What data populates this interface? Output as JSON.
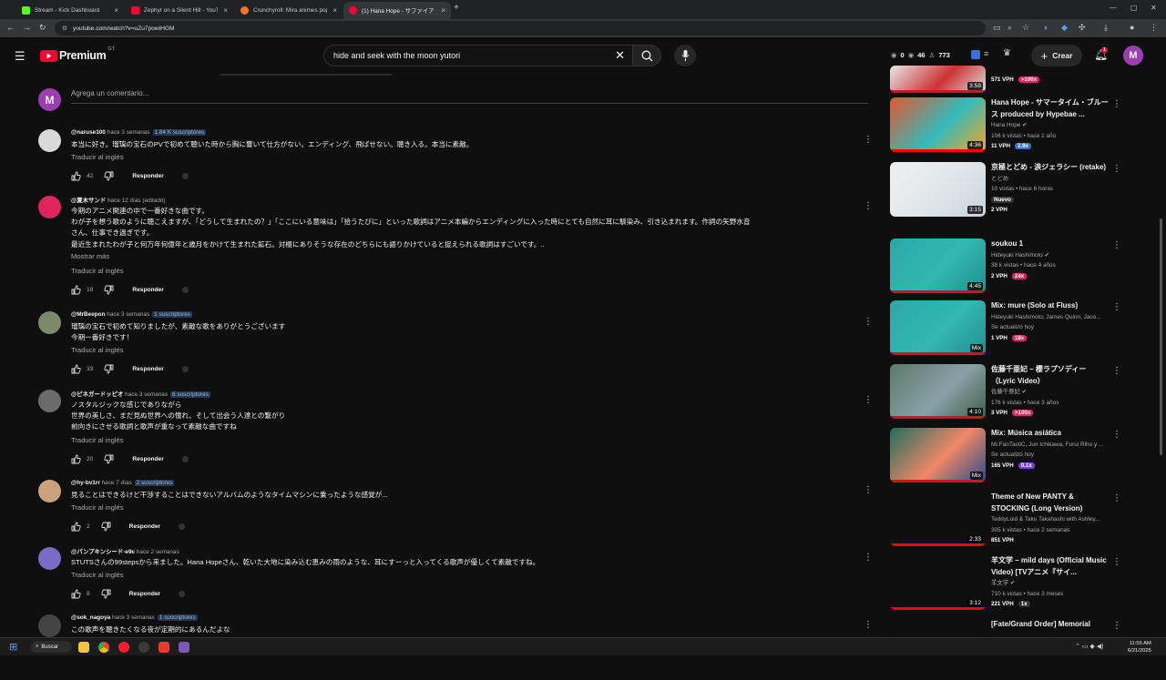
{
  "browser": {
    "tabs": [
      {
        "title": "Stream - Kick Dashboard",
        "color": "#53fc18",
        "active": false
      },
      {
        "title": "Zephyr on a Silent Hill - YouTub",
        "color": "#ff0033",
        "active": false
      },
      {
        "title": "Crunchyroll: Mira animes popul",
        "color": "#f47521",
        "active": false
      },
      {
        "title": "(1) Hana Hope - サファイア -",
        "color": "#ff0033",
        "active": true
      }
    ],
    "url": "youtube.com/watch?v=uZu7powiHGM"
  },
  "header": {
    "logo_text": "Premium",
    "logo_region": "GT",
    "search_value": "hide and seek with the moon yutori",
    "stats": {
      "views": "0",
      "watching": "46",
      "users": "773"
    },
    "create_label": "Crear",
    "notif_count": "1",
    "avatar_letter": "M"
  },
  "comment_box": {
    "placeholder": "Agrega un comentario..."
  },
  "comments": [
    {
      "author": "@naruse100",
      "time": "hace 3 semanas",
      "badge": "1.84 K suscriptores",
      "lines": [
        "本当に好き。瑠璃の宝石のPVで初めて聴いた時から胸に響いて仕方がない。エンディング、飛ばせない。聴き入る。本当に素敵。"
      ],
      "more": "",
      "translate": "Traducir al inglés",
      "likes": "42",
      "reply": "Responder",
      "avatar_color": "#d9d9d9"
    },
    {
      "author": "@夏木サンド",
      "time": "hace 12 días (editado)",
      "badge": "",
      "lines": [
        "今期のアニメ関連の中で一番好きな曲です。",
        "わが子を想う歌のように聴こえますが、「どうして生まれたの？」「ここにいる意味は」「拾うたびに」といった歌詞はアニメ本編からエンディングに入った時にとても自然に耳に馴染み、引き込まれます。作詞の矢野水音",
        "さん、仕事でき過ぎです。",
        "最近生まれたわが子と何万年何億年と歳月をかけて生まれた鉱石。対極にありそうな存在のどちらにも語りかけていると捉えられる歌詞はすごいです。.."
      ],
      "more": "Mostrar más",
      "translate": "Traducir al inglés",
      "likes": "18",
      "reply": "Responder",
      "avatar_color": "#e0245e"
    },
    {
      "author": "@MrBeepon",
      "time": "hace 3 semanas",
      "badge": "1 suscriptores",
      "lines": [
        "瑠璃の宝石で初めて知りましたが、素敵な歌をありがとうございます",
        "今期一番好きです！"
      ],
      "more": "",
      "translate": "Traducir al inglés",
      "likes": "33",
      "reply": "Responder",
      "avatar_color": "#7a8a6a"
    },
    {
      "author": "@ピネガードッピオ",
      "time": "hace 3 semanas",
      "badge": "6 suscriptores",
      "lines": [
        "ノスタルジックな感じでありながら",
        "世界の美しさ、まだ見ぬ世界への憧れ、そして出会う人達との繋がり",
        "前向きにさせる歌詞と歌声が重なって素敵な曲ですね"
      ],
      "more": "",
      "translate": "Traducir al inglés",
      "likes": "20",
      "reply": "Responder",
      "avatar_color": "#6b6b6b"
    },
    {
      "author": "@hy-bv1rr",
      "time": "hace 7 días",
      "badge": "2 suscriptores",
      "lines": [
        "見ることはできるけど干渉することはできないアルバムのようなタイムマシンに乗ったような感覚が..."
      ],
      "more": "",
      "translate": "Traducir al inglés",
      "likes": "2",
      "reply": "Responder",
      "avatar_color": "#c9a27e"
    },
    {
      "author": "@パンプキンシード-e9c",
      "time": "hace 2 semanas",
      "badge": "",
      "lines": [
        "STUTSさんの99stepsから来ました。Hana Hopeさん、乾いた大地に染み込む恵みの雨のような、耳にすーっと入ってくる歌声が優しくて素敵ですね。"
      ],
      "more": "",
      "translate": "Traducir al inglés",
      "likes": "8",
      "reply": "Responder",
      "avatar_color": "#7a6cc4"
    },
    {
      "author": "@sok_nagoya",
      "time": "hace 3 semanas",
      "badge": "1 suscriptores",
      "lines": [
        "この歌声を聴きたくなる夜が定期的にあるんだよな"
      ],
      "more": "",
      "translate": "",
      "likes": "",
      "reply": "",
      "avatar_color": "#444"
    }
  ],
  "sidebar": [
    {
      "title": "",
      "channel": "",
      "meta": "",
      "vph": "571 VPH",
      "pill": ">100x",
      "pill_color": "#e0245e",
      "duration": "3:58",
      "verified": false,
      "colors": [
        "#e8e8e8",
        "#c33",
        "#ddd"
      ]
    },
    {
      "title": "Hana Hope - サマータイム・ブルース produced by Hypebae ...",
      "channel": "Hana Hope",
      "meta": "106 k vistas • hace 1 año",
      "vph": "11 VPH",
      "pill": "2.9x",
      "pill_color": "#3a6fd8",
      "duration": "4:36",
      "verified": true,
      "colors": [
        "#e8552d",
        "#3bb",
        "#f5a623"
      ]
    },
    {
      "title": "京極とどめ - 涙ジェラシー (retake)",
      "channel": "とどめ",
      "meta": "10 vistas • hace 6 horas",
      "vph": "2 VPH",
      "pill": "Nuevo",
      "pill_color": "#333",
      "duration": "3:15",
      "verified": false,
      "colors": [
        "#f0f0f0",
        "#dfe6ea",
        "#c8d4dc"
      ],
      "nuevo_line": true
    },
    {
      "title": "soukou 1",
      "channel": "Hideyuki Hashimoto",
      "meta": "38 k vistas • hace 4 años",
      "vph": "2 VPH",
      "pill": "24x",
      "pill_color": "#e0245e",
      "duration": "4:45",
      "verified": true,
      "colors": [
        "#2aa8a8",
        "#34b6b2",
        "#1e8f90"
      ]
    },
    {
      "title": "Mix: mure (Solo at Fluss)",
      "channel": "Hideyuki Hashimoto, James Quinn, Jaco...",
      "meta": "Se actualizó hoy",
      "vph": "1 VPH",
      "pill": "18x",
      "pill_color": "#e0245e",
      "duration": "Mix",
      "verified": false,
      "colors": [
        "#2aa8a8",
        "#34b6b2",
        "#1e8f90"
      ]
    },
    {
      "title": "佐藤千亜妃 – 櫻ラプソディー（Lyric Video）",
      "channel": "佐藤千亜妃",
      "meta": "176 k vistas • hace 3 años",
      "vph": "3 VPH",
      "pill": ">100x",
      "pill_color": "#e0245e",
      "duration": "4:10",
      "verified": true,
      "colors": [
        "#5a7a6a",
        "#8aa0a8",
        "#3f5f4a"
      ]
    },
    {
      "title": "Mix: Música asiática",
      "channel": "Mr.FanTastiC, Jun Ichikawa, Furui Riho y ...",
      "meta": "Se actualizó hoy",
      "vph": "165 VPH",
      "pill": "9.1x",
      "pill_color": "#7a3ee0",
      "duration": "Mix",
      "verified": false,
      "colors": [
        "#1f6f5f",
        "#e86",
        "#2a4a8a"
      ]
    },
    {
      "title": "Theme of New PANTY & STOCKING (Long Version)",
      "channel": "TeddyLoid & Taku Takahashi with Ashley...",
      "meta": "305 k vistas • hace 2 semanas",
      "vph": "851 VPH",
      "pill": "",
      "pill_color": "#333",
      "duration": "2:33",
      "verified": false,
      "colors": [
        "#0f0f0f",
        "#0f0f0f",
        "#0f0f0f"
      ]
    },
    {
      "title": "羊文学 – mild days (Official Music Video) [TVアニメ『サイ...",
      "channel": "羊文学",
      "meta": "710 k vistas • hace 3 meses",
      "vph": "221 VPH",
      "pill": "1x",
      "pill_color": "#333",
      "duration": "3:12",
      "verified": true,
      "colors": [
        "#0f0f0f",
        "#0f0f0f",
        "#0f0f0f"
      ]
    },
    {
      "title": "[Fate/Grand Order] Memorial",
      "channel": "",
      "meta": "",
      "vph": "",
      "pill": "",
      "pill_color": "#333",
      "duration": "",
      "verified": false,
      "colors": [
        "#0f0f0f",
        "#0f0f0f",
        "#0f0f0f"
      ]
    }
  ],
  "taskbar": {
    "search_label": "Buscar",
    "time": "11:55 AM",
    "date": "6/21/2025"
  },
  "theme": {
    "accent": "#ff0033",
    "bg": "#0f0f0f",
    "text": "#f1f1f1",
    "muted": "#aaaaaa"
  }
}
